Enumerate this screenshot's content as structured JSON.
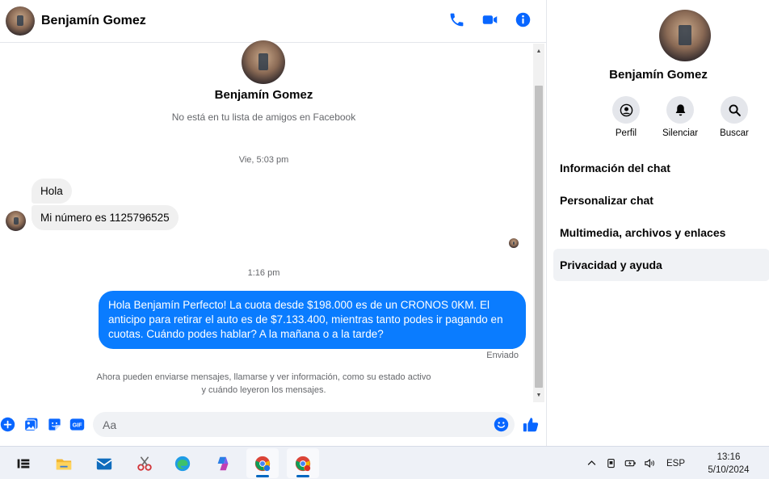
{
  "chat_header": {
    "name": "Benjamín Gomez",
    "actions": [
      "phone-icon",
      "video-camera-icon",
      "info-icon"
    ]
  },
  "conversation": {
    "profile_name": "Benjamín Gomez",
    "profile_subtitle": "No está en tu lista de amigos en Facebook",
    "timestamp_1": "Vie, 5:03 pm",
    "incoming": [
      "Hola",
      "Mi número es 1125796525"
    ],
    "timestamp_2": "1:16 pm",
    "outgoing": "Hola Benjamín Perfecto! La cuota desde $198.000 es de un CRONOS 0KM. El anticipo para retirar el auto es de $7.133.400, mientras tanto podes ir pagando en cuotas. Cuándo podes hablar? A la mañana o a la tarde?",
    "status": "Enviado",
    "notice_line1": "Ahora pueden enviarse mensajes, llamarse y ver información, como su estado activo",
    "notice_line2": "y cuándo leyeron los mensajes."
  },
  "composer": {
    "placeholder": "Aa",
    "gif_label": "GIF"
  },
  "right_panel": {
    "name": "Benjamín Gomez",
    "actions": [
      {
        "label": "Perfil",
        "icon": "profile-icon"
      },
      {
        "label": "Silenciar",
        "icon": "bell-icon"
      },
      {
        "label": "Buscar",
        "icon": "search-icon"
      }
    ],
    "menu": [
      "Información del chat",
      "Personalizar chat",
      "Multimedia, archivos y enlaces",
      "Privacidad y ayuda"
    ]
  },
  "colors": {
    "accent": "#0a7cff",
    "icon_blue": "#0866ff"
  },
  "taskbar": {
    "language": "ESP",
    "time": "13:16",
    "date": "5/10/2024"
  }
}
